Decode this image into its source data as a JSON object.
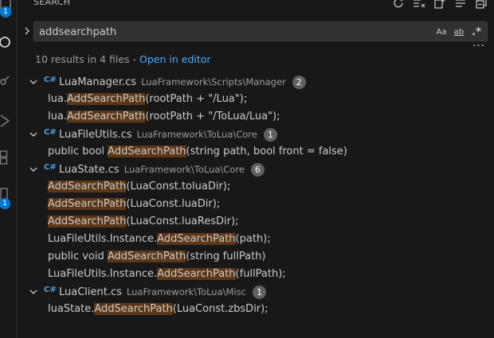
{
  "panel": {
    "title": "SEARCH",
    "query": "addsearchpath",
    "case_label": "Aa",
    "word_label": "ab",
    "regex_label": ".*",
    "summary": "10 results in 4 files - ",
    "open_in_editor": "Open in editor"
  },
  "activity": {
    "explorer_badge": "1",
    "extensions_badge": "1"
  },
  "files": [
    {
      "icon": "C#",
      "name": "LuaManager.cs",
      "path": "LuaFramework\\Scripts\\Manager",
      "count": "2",
      "matches": [
        {
          "pre": "lua.",
          "match": "AddSearchPath",
          "post": "(rootPath + \"/Lua\");"
        },
        {
          "pre": "lua.",
          "match": "AddSearchPath",
          "post": "(rootPath + \"/ToLua/Lua\");"
        }
      ]
    },
    {
      "icon": "C#",
      "name": "LuaFileUtils.cs",
      "path": "LuaFramework\\ToLua\\Core",
      "count": "1",
      "matches": [
        {
          "pre": "public bool ",
          "match": "AddSearchPath",
          "post": "(string path, bool front = false)"
        }
      ]
    },
    {
      "icon": "C#",
      "name": "LuaState.cs",
      "path": "LuaFramework\\ToLua\\Core",
      "count": "6",
      "matches": [
        {
          "pre": "",
          "match": "AddSearchPath",
          "post": "(LuaConst.toluaDir);"
        },
        {
          "pre": "",
          "match": "AddSearchPath",
          "post": "(LuaConst.luaDir);"
        },
        {
          "pre": "",
          "match": "AddSearchPath",
          "post": "(LuaConst.luaResDir);"
        },
        {
          "pre": "LuaFileUtils.Instance.",
          "match": "AddSearchPath",
          "post": "(path);"
        },
        {
          "pre": "public void ",
          "match": "AddSearchPath",
          "post": "(string fullPath)"
        },
        {
          "pre": "LuaFileUtils.Instance.",
          "match": "AddSearchPath",
          "post": "(fullPath);"
        }
      ]
    },
    {
      "icon": "C#",
      "name": "LuaClient.cs",
      "path": "LuaFramework\\ToLua\\Misc",
      "count": "1",
      "matches": [
        {
          "pre": "luaState.",
          "match": "AddSearchPath",
          "post": "(LuaConst.zbsDir);"
        }
      ]
    }
  ],
  "colors": {
    "background": "#181818",
    "highlight": "#5c3717",
    "link": "#4daafc",
    "badge": "#0078d4"
  }
}
